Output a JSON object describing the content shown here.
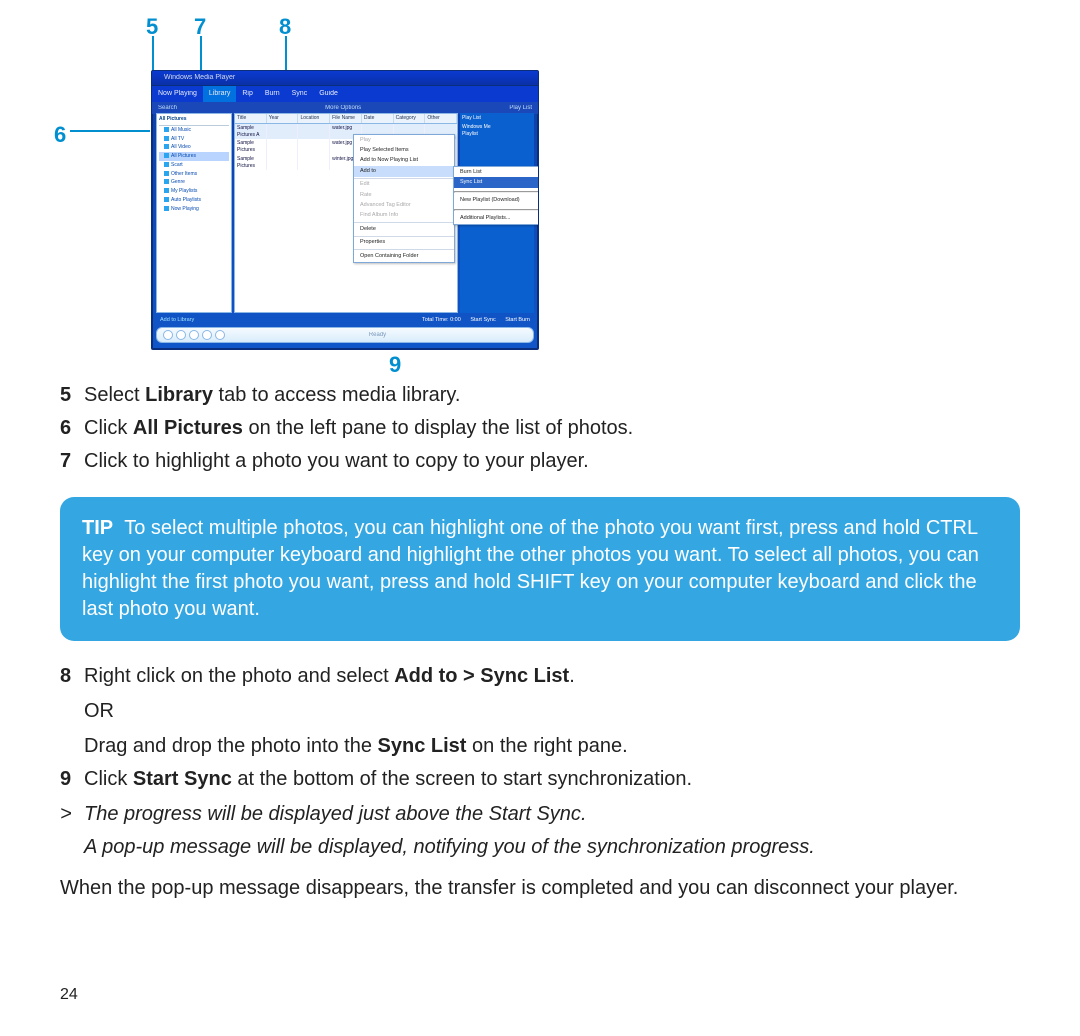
{
  "callouts": {
    "c5": "5",
    "c6": "6",
    "c7": "7",
    "c8": "8",
    "c9": "9"
  },
  "screenshot": {
    "window_title": "Windows Media Player",
    "menu_tabs": {
      "now_playing": "Now Playing",
      "library": "Library",
      "rip": "Rip",
      "burn": "Burn",
      "sync": "Sync",
      "guide": "Guide"
    },
    "toolbar": {
      "search": "Search",
      "more": "More Options",
      "playlist": "Play List"
    },
    "leftpane": {
      "header": "All Pictures",
      "items": [
        "All Music",
        "All TV",
        "All Video",
        "All Pictures",
        "Scart",
        "Other Items",
        "Genre",
        "My Playlists",
        "Auto Playlists",
        "Now Playing"
      ]
    },
    "columns": {
      "title": "Title",
      "year": "Year",
      "location": "Location",
      "file_name": "File Name",
      "date": "Date",
      "category": "Category",
      "other": "Other"
    },
    "rows": {
      "r1": {
        "title": "Sample Pictures A",
        "file": "water.jpg"
      },
      "r2": {
        "title": "Sample Pictures",
        "file": "water.jpg"
      },
      "r3": {
        "title": "Sample Pictures",
        "file": "winter.jpg"
      }
    },
    "context_menu": {
      "play": "Play",
      "play_selected": "Play Selected Items",
      "addto_now": "Add to Now Playing List",
      "addto": "Add to",
      "edit": "Edit",
      "rate": "Rate",
      "adv_tag": "Advanced Tag Editor",
      "find_info": "Find Album Info",
      "delete": "Delete",
      "properties": "Properties",
      "open_folder": "Open Containing Folder"
    },
    "submenu": {
      "burn": "Burn List",
      "sync": "Sync List",
      "download": "New Playlist (Download)",
      "additional": "Additional Playlists..."
    },
    "rightpane": {
      "header": "Play List",
      "line1": "Windows Me",
      "line2": "Playlist"
    },
    "bottombar": {
      "left": "Add to Library",
      "total": "Total Time: 0:00",
      "startsync": "Start Sync",
      "startburn": "Start Burn"
    },
    "ctrlbar": {
      "label": "Ready"
    }
  },
  "steps": {
    "s5": {
      "pre": "Select ",
      "b": "Library",
      "post": " tab to access media library."
    },
    "s6": {
      "pre": "Click ",
      "b": "All Pictures",
      "post": " on the left pane to display the list of photos."
    },
    "s7": {
      "text": "Click to highlight a photo you want to copy to your player."
    },
    "s8": {
      "line1": {
        "pre": "Right click on the photo and select ",
        "b": "Add to > Sync List",
        "post": "."
      },
      "or": "OR",
      "line2": {
        "pre": "Drag and drop the photo into the ",
        "b": "Sync List",
        "post": " on the right pane."
      }
    },
    "s9": {
      "pre": "Click ",
      "b": "Start Sync",
      "post": " at the bottom of the screen to start synchronization."
    },
    "result1": {
      "pre": "The progress will be displayed just above the ",
      "b": "Start Sync",
      "post": "."
    },
    "result2": "A pop-up message will be displayed, notifying you of the synchronization progress."
  },
  "tip": {
    "label": "TIP",
    "body": "To select multiple photos, you can highlight one of the photo you want first, press and hold CTRL key on your computer keyboard and highlight the other photos you want. To select all photos, you can highlight the first photo you want, press and hold SHIFT key on your computer keyboard and click the last photo you want."
  },
  "finish": "When the pop-up message disappears, the transfer is completed and you can disconnect your player.",
  "page_number": "24"
}
